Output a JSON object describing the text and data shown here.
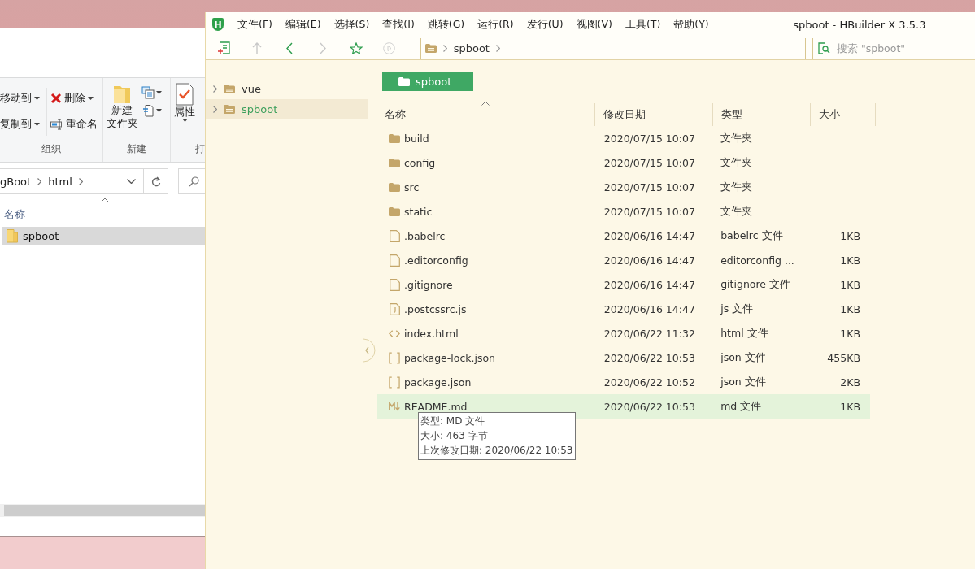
{
  "explorer": {
    "ribbon": {
      "organize_label": "组织",
      "move_to": "移动到",
      "copy_to": "复制到",
      "delete": "删除",
      "rename": "重命名",
      "new_label": "新建",
      "new_folder": [
        "新建",
        "文件夹"
      ],
      "open_label": "打",
      "properties": "属性"
    },
    "address": [
      "gBoot",
      "html"
    ],
    "column": "名称",
    "rows": [
      {
        "name": "spboot",
        "selected": true
      }
    ]
  },
  "hbuilder": {
    "logo": "H",
    "title": "spboot - HBuilder X 3.5.3",
    "menus": [
      "文件(F)",
      "编辑(E)",
      "选择(S)",
      "查找(I)",
      "跳转(G)",
      "运行(R)",
      "发行(U)",
      "视图(V)",
      "工具(T)",
      "帮助(Y)"
    ],
    "breadcrumb": [
      "spboot"
    ],
    "search": {
      "placeholder": "搜索 \"spboot\""
    },
    "tree": [
      {
        "name": "vue",
        "selected": false
      },
      {
        "name": "spboot",
        "selected": true
      }
    ],
    "folder_button": "spboot",
    "columns": [
      "名称",
      "修改日期",
      "类型",
      "大小"
    ],
    "files": [
      {
        "kind": "folder",
        "name": "build",
        "date": "2020/07/15 10:07",
        "type": "文件夹",
        "selected": false
      },
      {
        "kind": "folder",
        "name": "config",
        "date": "2020/07/15 10:07",
        "type": "文件夹",
        "selected": false
      },
      {
        "kind": "folder",
        "name": "src",
        "date": "2020/07/15 10:07",
        "type": "文件夹",
        "selected": false
      },
      {
        "kind": "folder",
        "name": "static",
        "date": "2020/07/15 10:07",
        "type": "文件夹",
        "selected": false
      },
      {
        "kind": "file",
        "name": ".babelrc",
        "date": "2020/06/16 14:47",
        "type": "babelrc 文件",
        "size": "1KB",
        "selected": false
      },
      {
        "kind": "file",
        "name": ".editorconfig",
        "date": "2020/06/16 14:47",
        "type": "editorconfig ...",
        "size": "1KB",
        "selected": false
      },
      {
        "kind": "file",
        "name": ".gitignore",
        "date": "2020/06/16 14:47",
        "type": "gitignore 文件",
        "size": "1KB",
        "selected": false
      },
      {
        "kind": "js",
        "name": ".postcssrc.js",
        "date": "2020/06/16 14:47",
        "type": "js 文件",
        "size": "1KB",
        "selected": false
      },
      {
        "kind": "html",
        "name": "index.html",
        "date": "2020/06/22 11:32",
        "type": "html 文件",
        "size": "1KB",
        "selected": false
      },
      {
        "kind": "json",
        "name": "package-lock.json",
        "date": "2020/06/22 10:53",
        "type": "json 文件",
        "size": "455KB",
        "selected": false
      },
      {
        "kind": "json",
        "name": "package.json",
        "date": "2020/06/22 10:52",
        "type": "json 文件",
        "size": "2KB",
        "selected": false
      },
      {
        "kind": "md",
        "name": "README.md",
        "date": "2020/06/22 10:53",
        "type": "md 文件",
        "size": "1KB",
        "selected": true
      }
    ],
    "tooltip": [
      "类型: MD 文件",
      "大小: 463 字节",
      "上次修改日期: 2020/06/22 10:53"
    ]
  }
}
